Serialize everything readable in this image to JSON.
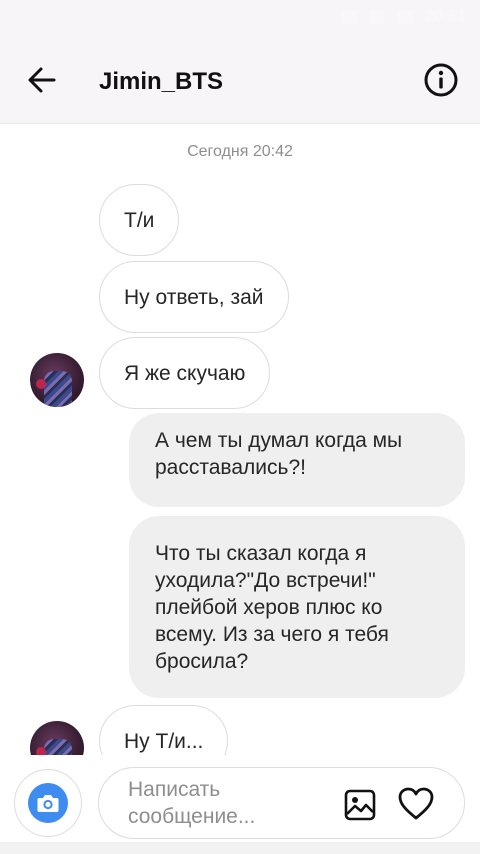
{
  "status_bar": {
    "time": "20:51"
  },
  "header": {
    "title": "Jimin_BTS",
    "back_icon": "back-arrow-icon",
    "info_icon": "info-icon"
  },
  "chat": {
    "timestamp": "Сегодня 20:42",
    "messages": [
      {
        "direction": "incoming",
        "text": "Т/и"
      },
      {
        "direction": "incoming",
        "text": "Ну ответь, зай"
      },
      {
        "direction": "incoming",
        "text": "Я же скучаю"
      },
      {
        "direction": "outgoing",
        "text": "А чем ты думал когда мы расставались?!"
      },
      {
        "direction": "outgoing",
        "text": "Что ты сказал когда я уходила?\"До встречи!\" плейбой херов плюс ко всему. Из за чего я тебя бросила?"
      },
      {
        "direction": "incoming",
        "text": "Ну Т/и..."
      }
    ]
  },
  "composer": {
    "placeholder": "Написать сообщение...",
    "camera_icon": "camera-icon",
    "gallery_icon": "gallery-icon",
    "like_icon": "heart-icon",
    "accent_color": "#3f8cf0"
  }
}
